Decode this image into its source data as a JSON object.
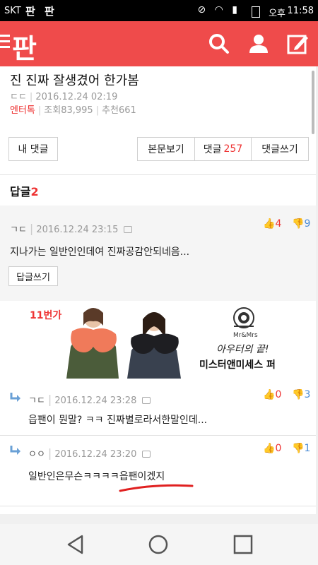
{
  "status_bar": {
    "carrier": "SKT",
    "app_icons": "판 판",
    "system_icons": "⊘ ◠ ▮",
    "ampm": "오후",
    "time": "11:58"
  },
  "header": {
    "logo": "판",
    "brand_color": "#ef4b4b",
    "icons": [
      "search-icon",
      "user-icon",
      "write-icon"
    ]
  },
  "post": {
    "title": "진 진짜 잘생겼어 한가봄",
    "author": "ㄷㄷ",
    "date": "2016.12.24 02:19",
    "category": "엔터톡",
    "views": "조회83,995",
    "recommends": "추천661"
  },
  "buttons": {
    "my_comments": "내 댓글",
    "view_body": "본문보기",
    "comments_label": "댓글",
    "comments_count": "257",
    "write_comment": "댓글쓰기"
  },
  "replies": {
    "label": "답글",
    "count": "2"
  },
  "main_comment": {
    "author": "ㄱㄷ",
    "date": "2016.12.24 23:15",
    "text": "지나가는 일반인인데여 진짜공감안되네음...",
    "likes": "4",
    "dislikes": "9",
    "reply_button": "답글쓰기"
  },
  "ad": {
    "brand": "11번가",
    "logo_text": "Mr&Mrs",
    "line1": "아우터의 끝!",
    "line2": "미스터앤미세스 퍼"
  },
  "reply_items": [
    {
      "author": "ㄱㄷ",
      "date": "2016.12.24 23:28",
      "text": "읍팬이 뭔말? ㅋㅋ 진짜별로라서한말인데...",
      "likes": "0",
      "dislikes": "3"
    },
    {
      "author": "ㅇㅇ",
      "date": "2016.12.24 23:20",
      "text": "일반인은무슨ㅋㅋㅋㅋ읍팬이겠지",
      "likes": "0",
      "dislikes": "1"
    }
  ],
  "nav_bar": {
    "icons": [
      "back-icon",
      "home-icon",
      "recent-apps-icon"
    ]
  }
}
